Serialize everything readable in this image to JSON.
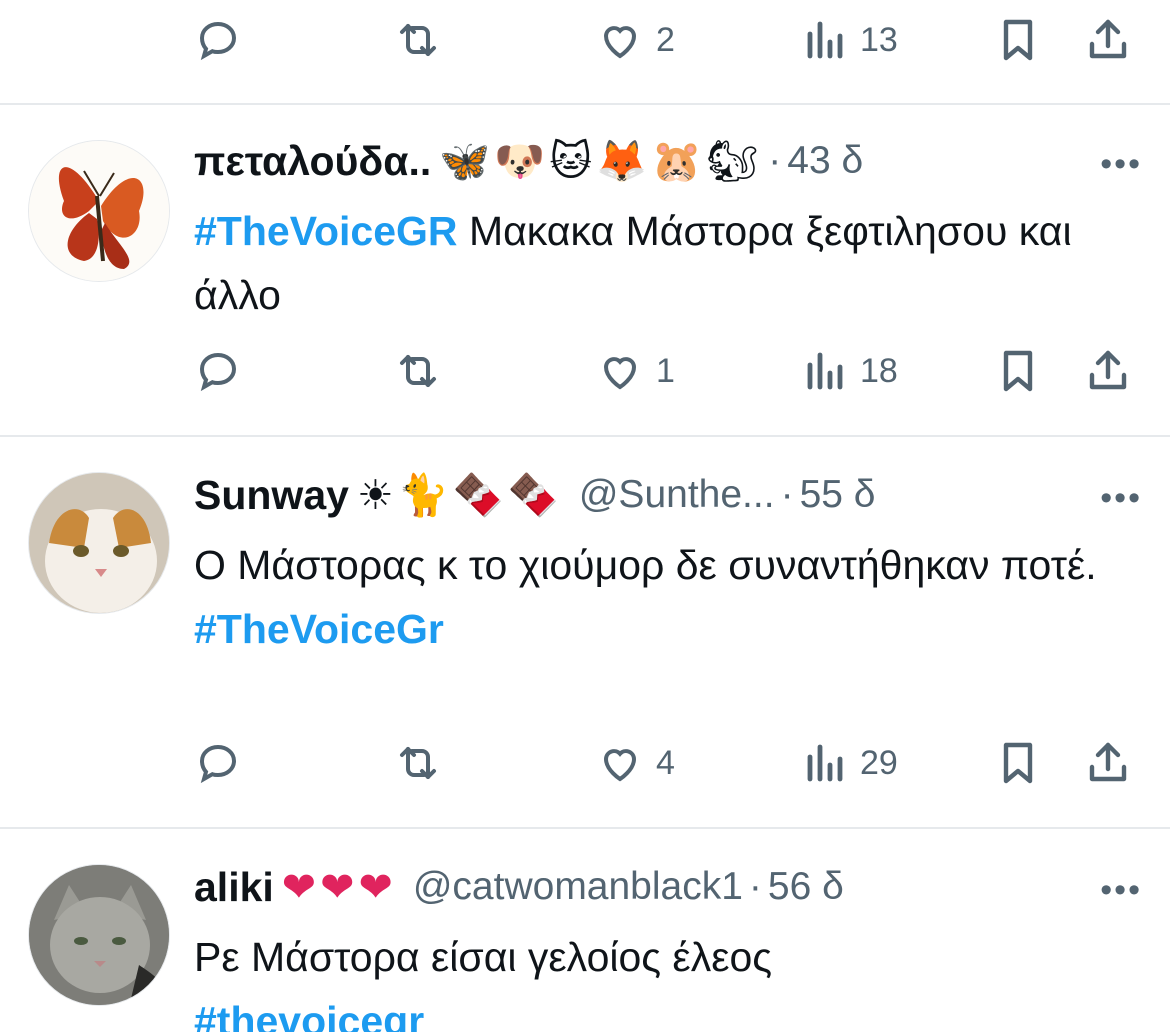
{
  "top_actions": {
    "like_count": "2",
    "views_count": "13"
  },
  "tweets": [
    {
      "name": "πεταλούδα..",
      "emojis": "🦋🐶🐱🦊🐹🐿",
      "handle": "",
      "time": "43 δ",
      "more": "•••",
      "hashtag": "#TheVoiceGR",
      "text": " Μακακα Μάστορα ξεφτιλησου και άλλο",
      "text_after": "",
      "reply_count": "",
      "retweet_count": "",
      "like_count": "1",
      "views_count": "18"
    },
    {
      "name": "Sunway",
      "emojis": "☀🐈🍫🍫",
      "handle": "@Sunthe...",
      "time": "55 δ",
      "more": "•••",
      "text": "Ο Μάστορας κ το χιούμορ δε συναντήθηκαν ποτέ.",
      "hashtag": "#TheVoiceGr",
      "like_count": "4",
      "views_count": "29"
    },
    {
      "name": "aliki",
      "emojis": "❤❤❤",
      "handle": "@catwomanblack1",
      "time": "56 δ",
      "more": "•••",
      "text": "Ρε Μάστορα είσαι γελοίος έλεος",
      "hashtag": "#thevoicegr"
    }
  ],
  "colors": {
    "accent": "#1d9bf0",
    "secondary_text": "#536471",
    "divider": "#e6e9ec"
  }
}
